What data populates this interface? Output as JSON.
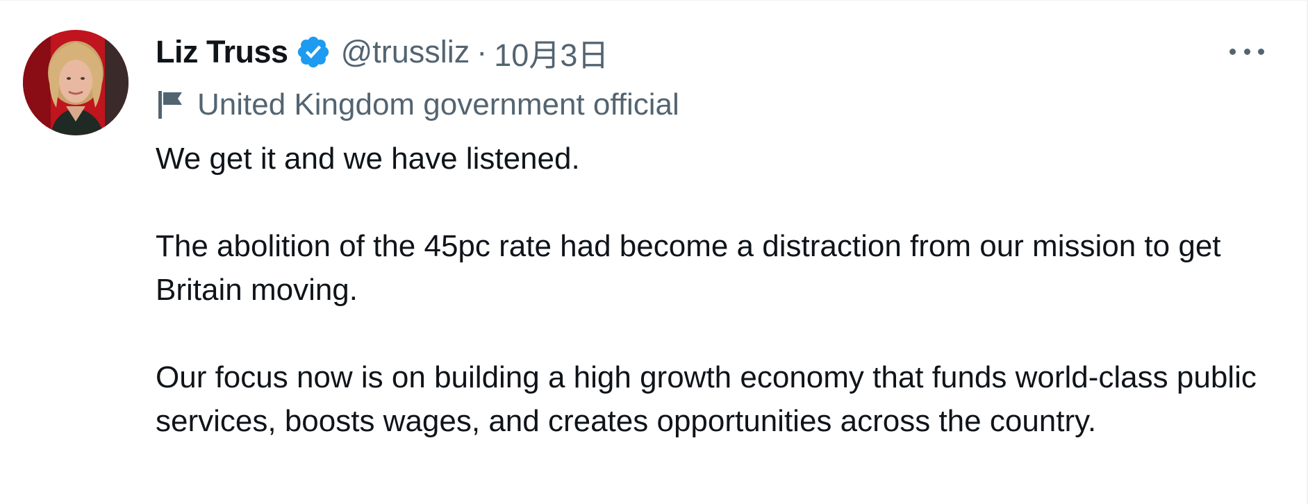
{
  "tweet": {
    "display_name": "Liz Truss",
    "handle": "@trussliz",
    "separator": "·",
    "timestamp": "10月3日",
    "label": "United Kingdom government official",
    "paragraphs": [
      "We get it and we have listened.",
      "The abolition of the 45pc rate had become a distraction from our mission to get Britain moving.",
      "Our focus now is on building a high growth economy that funds world-class public services, boosts wages, and creates opportunities across the country."
    ]
  },
  "icons": {
    "verified": "verified-badge-icon",
    "label": "flag-icon",
    "more": "more-icon"
  },
  "colors": {
    "text_primary": "#0f1419",
    "text_secondary": "#536471",
    "verified_blue": "#1d9bf0",
    "avatar_background": "#c0141e"
  }
}
